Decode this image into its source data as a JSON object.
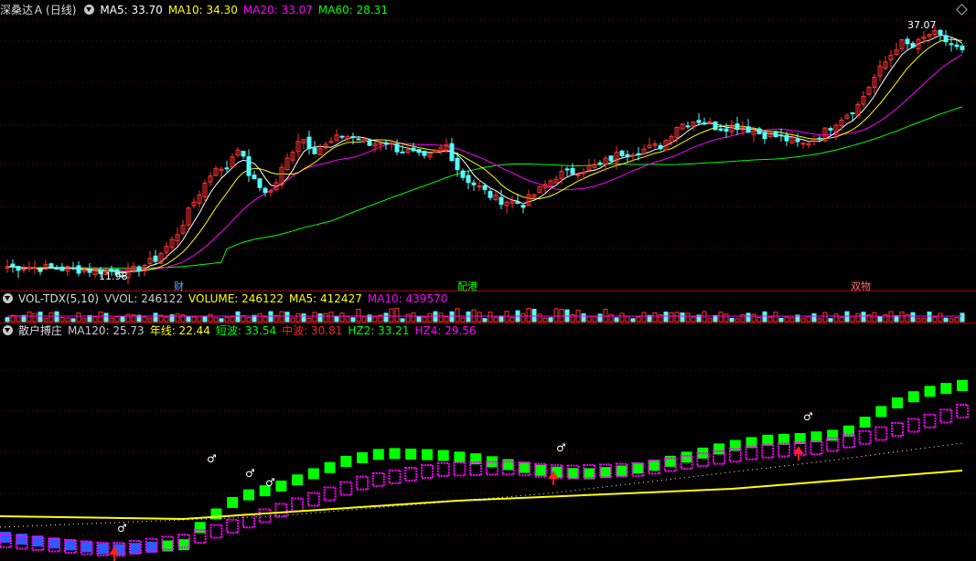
{
  "main_panel": {
    "stock_name": "深桑达Ａ",
    "period": "(日线)",
    "indicators": [
      {
        "label": "MA5: 33.70",
        "color": "#ffffff"
      },
      {
        "label": "MA10: 34.30",
        "color": "#ffff00"
      },
      {
        "label": "MA20: 33.07",
        "color": "#ff00ff"
      },
      {
        "label": "MA60: 28.31",
        "color": "#00ff00"
      }
    ],
    "high_label": "37.07",
    "low_label": "11.98",
    "markers": [
      {
        "label": "财",
        "color": "#5ab4ff"
      },
      {
        "label": "配港",
        "color": "#00ff00"
      },
      {
        "label": "双物",
        "color": "#ff7070"
      }
    ]
  },
  "volume_panel": {
    "name": "VOL-TDX(5,10)",
    "indicators": [
      {
        "label": "VVOL: 246122",
        "color": "#cccccc"
      },
      {
        "label": "VOLUME: 246122",
        "color": "#ffff00"
      },
      {
        "label": "MA5: 412427",
        "color": "#ffff00"
      },
      {
        "label": "MA10: 439570",
        "color": "#ff00ff"
      }
    ]
  },
  "indicator_panel": {
    "name": "散户搏庄",
    "indicators": [
      {
        "label": "MA120: 25.73",
        "color": "#cccccc"
      },
      {
        "label": "年线: 22.44",
        "color": "#ffff00"
      },
      {
        "label": "短波: 33.54",
        "color": "#00ff00"
      },
      {
        "label": "中波: 30.81",
        "color": "#ff2020"
      },
      {
        "label": "HZ2: 33.21",
        "color": "#00ff00"
      },
      {
        "label": "HZ4: 29.56",
        "color": "#ff00ff"
      }
    ],
    "symbol": "♂"
  },
  "colors": {
    "up": "#ff3232",
    "down": "#54fcfc",
    "ma5": "#ffffff",
    "ma10": "#ffff00",
    "ma20": "#ff00ff",
    "ma60": "#00ff00",
    "divider": "#b00000"
  }
}
